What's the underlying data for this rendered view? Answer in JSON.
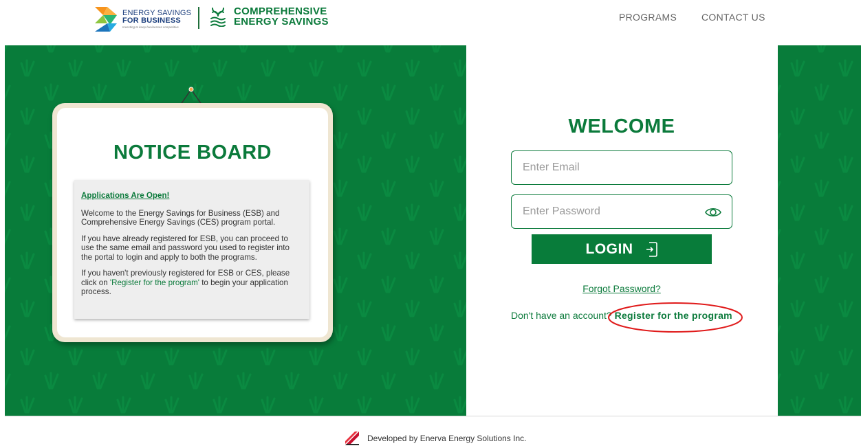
{
  "header": {
    "esb_logo": {
      "line1": "ENERGY SAVINGS",
      "line2": "FOR BUSINESS",
      "tagline": "Investing to keep businesses competitive"
    },
    "ces_logo": {
      "line1": "COMPREHENSIVE",
      "line2": "ENERGY SAVINGS"
    },
    "nav": [
      {
        "label": "PROGRAMS"
      },
      {
        "label": "CONTACT US"
      }
    ]
  },
  "notice_board": {
    "title": "NOTICE BOARD",
    "link": "Applications Are Open!",
    "paragraph1": "Welcome to the Energy Savings for Business (ESB) and Comprehensive Energy Savings (CES) program portal.",
    "paragraph2": "If you have already registered for ESB, you can proceed to use the same email and password you used to register into the portal to login and apply to both the programs.",
    "paragraph3_before": "If you haven't previously registered for ESB or CES, please click on ",
    "paragraph3_link": "'Register for the program'",
    "paragraph3_after": " to begin your application process."
  },
  "login": {
    "title": "WELCOME",
    "email_placeholder": "Enter Email",
    "password_placeholder": "Enter Password",
    "button_label": "LOGIN",
    "forgot": "Forgot Password?",
    "no_account": "Don't have an account?",
    "register_link": "Register for the program"
  },
  "footer": {
    "text": "Developed by Enerva Energy Solutions Inc."
  },
  "colors": {
    "brand_green": "#087c3a",
    "text_green": "#0b7a3b",
    "highlight_red": "#e01b1b"
  },
  "icons": {
    "password_toggle": "eye-icon",
    "login": "login-arrow-icon",
    "footer": "enerva-logo-icon"
  }
}
